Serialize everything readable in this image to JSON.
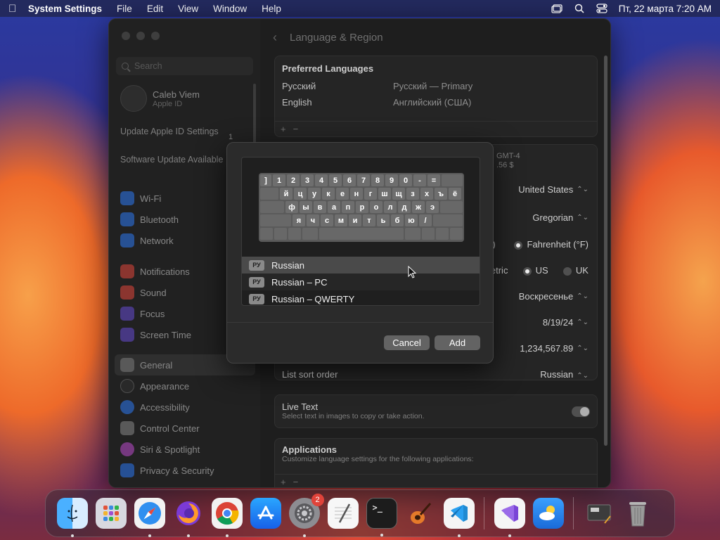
{
  "menubar": {
    "app_name": "System Settings",
    "menus": [
      "File",
      "Edit",
      "View",
      "Window",
      "Help"
    ],
    "datetime": "Пт, 22 марта  7:20 AM"
  },
  "sidebar": {
    "search_placeholder": "Search",
    "user_name": "Caleb Viem",
    "user_sub": "Apple ID",
    "update_apple_id": "Update Apple ID Settings",
    "update_badge": "1",
    "software_update": "Software Update Available",
    "items": [
      {
        "label": "Wi-Fi",
        "color": "#2f7bf6"
      },
      {
        "label": "Bluetooth",
        "color": "#2f7bf6"
      },
      {
        "label": "Network",
        "color": "#2f7bf6"
      },
      {
        "label": "Notifications",
        "color": "#e5483d"
      },
      {
        "label": "Sound",
        "color": "#e5483d"
      },
      {
        "label": "Focus",
        "color": "#6a4fd6"
      },
      {
        "label": "Screen Time",
        "color": "#6a4fd6"
      },
      {
        "label": "General",
        "color": "#8a8a8a"
      },
      {
        "label": "Appearance",
        "color": "#333333"
      },
      {
        "label": "Accessibility",
        "color": "#2f7bf6"
      },
      {
        "label": "Control Center",
        "color": "#8a8a8a"
      },
      {
        "label": "Siri & Spotlight",
        "color": "#c04fd0"
      },
      {
        "label": "Privacy & Security",
        "color": "#2f7bf6"
      }
    ]
  },
  "content": {
    "title": "Language & Region",
    "preferred_languages_title": "Preferred Languages",
    "languages": [
      {
        "name": "Русский",
        "desc": "Русский — Primary"
      },
      {
        "name": "English",
        "desc": "Английский (США)"
      }
    ],
    "timezone_partial": "GMT-4",
    "currency_partial": ".56 $",
    "region_value": "United States",
    "calendar_value": "Gregorian",
    "temp_c_partial": "C)",
    "temp_f": "Fahrenheit (°F)",
    "measure_metric_partial": "letric",
    "measure_us": "US",
    "measure_uk": "UK",
    "first_day_value": "Воскресенье",
    "date_format_value": "8/19/24",
    "number_format_value": "1,234,567.89",
    "list_sort_label": "List sort order",
    "list_sort_value": "Russian",
    "live_text_title": "Live Text",
    "live_text_desc": "Select text in images to copy or take action.",
    "applications_title": "Applications",
    "applications_desc": "Customize language settings for the following applications:"
  },
  "sheet": {
    "keyboard_rows": [
      [
        "]",
        "1",
        "2",
        "3",
        "4",
        "5",
        "6",
        "7",
        "8",
        "9",
        "0",
        "-",
        "="
      ],
      [
        "й",
        "ц",
        "у",
        "к",
        "е",
        "н",
        "г",
        "ш",
        "щ",
        "з",
        "х",
        "ъ",
        "ё"
      ],
      [
        "ф",
        "ы",
        "в",
        "а",
        "п",
        "р",
        "о",
        "л",
        "д",
        "ж",
        "э"
      ],
      [
        "я",
        "ч",
        "с",
        "м",
        "и",
        "т",
        "ь",
        "б",
        "ю",
        "/"
      ]
    ],
    "layouts": [
      {
        "badge": "РУ",
        "label": "Russian"
      },
      {
        "badge": "РУ",
        "label": "Russian – PC"
      },
      {
        "badge": "РУ",
        "label": "Russian – QWERTY"
      }
    ],
    "cancel_label": "Cancel",
    "add_label": "Add"
  },
  "dock": {
    "apps": [
      {
        "name": "finder",
        "color": "#2a8df0"
      },
      {
        "name": "launchpad",
        "color": "#d8d8e0"
      },
      {
        "name": "safari",
        "color": "#2f8ff0"
      },
      {
        "name": "firefox",
        "color": "#7b3ad6"
      },
      {
        "name": "chrome",
        "color": "#f2f2f2"
      },
      {
        "name": "app-store",
        "color": "#1f8bf3"
      },
      {
        "name": "system-settings",
        "color": "#8d8d92",
        "badge": "2"
      },
      {
        "name": "textedit",
        "color": "#f2f2f2"
      },
      {
        "name": "terminal",
        "color": "#1c1c1c"
      },
      {
        "name": "garageband",
        "color": "#6b3a1e"
      },
      {
        "name": "vscode",
        "color": "#f5f5f5"
      },
      {
        "name": "visual-studio",
        "color": "#f5f5f5"
      },
      {
        "name": "weather",
        "color": "#2f86e8"
      },
      {
        "name": "preview-folder",
        "color": "#3c3c3c"
      },
      {
        "name": "trash",
        "color": "#9a9a9a"
      }
    ]
  }
}
